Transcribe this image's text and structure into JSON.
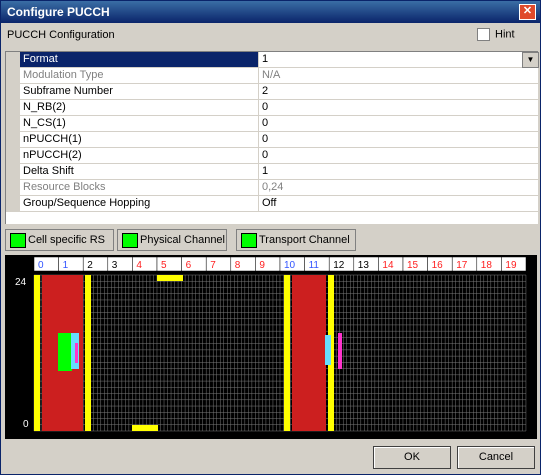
{
  "window": {
    "title": "Configure PUCCH"
  },
  "header": {
    "label": "PUCCH Configuration",
    "hint_label": "Hint"
  },
  "rows": [
    {
      "name": "Format",
      "value": "1"
    },
    {
      "name": "Modulation Type",
      "value": "N/A"
    },
    {
      "name": "Subframe Number",
      "value": "2"
    },
    {
      "name": "N_RB(2)",
      "value": "0"
    },
    {
      "name": "N_CS(1)",
      "value": "0"
    },
    {
      "name": "nPUCCH(1)",
      "value": "0"
    },
    {
      "name": "nPUCCH(2)",
      "value": "0"
    },
    {
      "name": "Delta Shift",
      "value": "1"
    },
    {
      "name": "Resource Blocks",
      "value": "0,24"
    },
    {
      "name": "Group/Sequence Hopping",
      "value": "Off"
    }
  ],
  "legend": [
    "Cell specific RS",
    "Physical Channel",
    "Transport Channel"
  ],
  "timeline": {
    "slots": [
      "0",
      "1",
      "2",
      "3",
      "4",
      "5",
      "6",
      "7",
      "8",
      "9",
      "10",
      "11",
      "12",
      "13",
      "14",
      "15",
      "16",
      "17",
      "18",
      "19"
    ],
    "y_top": "24",
    "y_bottom": "0"
  },
  "buttons": {
    "ok": "OK",
    "cancel": "Cancel"
  },
  "colors": {
    "slot_blue": "#3355ff",
    "slot_red": "#ff2020",
    "slot_white": "#ffffff",
    "grid": "#7a7a7a",
    "rs": "#00ff00",
    "pucch": "#cc1f1f",
    "yellow": "#ffff00"
  }
}
